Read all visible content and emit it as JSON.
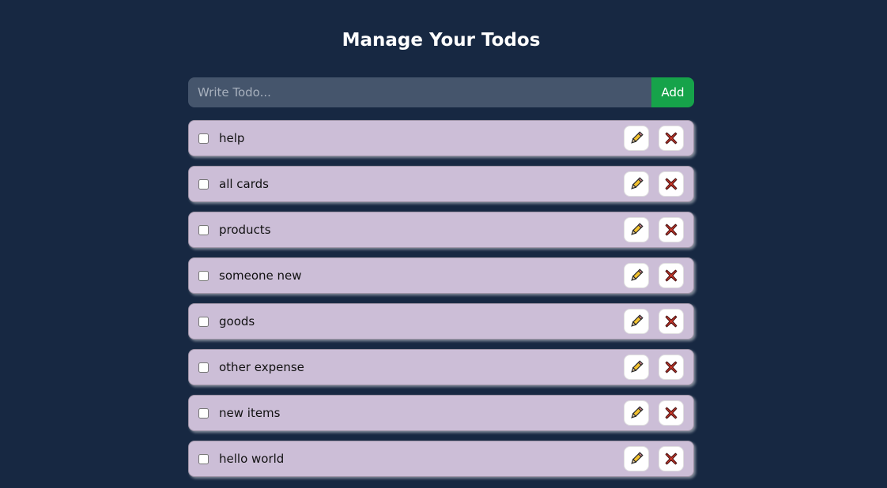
{
  "header": {
    "title": "Manage Your Todos"
  },
  "form": {
    "placeholder": "Write Todo...",
    "value": "",
    "add_label": "Add"
  },
  "todos": [
    {
      "text": "help",
      "completed": false
    },
    {
      "text": "all cards",
      "completed": false
    },
    {
      "text": "products",
      "completed": false
    },
    {
      "text": "someone new",
      "completed": false
    },
    {
      "text": "goods",
      "completed": false
    },
    {
      "text": "other expense",
      "completed": false
    },
    {
      "text": "new items",
      "completed": false
    },
    {
      "text": "hello world",
      "completed": false
    }
  ],
  "icons": {
    "edit": "pencil-icon",
    "delete": "cross-mark-icon"
  },
  "colors": {
    "background": "#172842",
    "input": "#45556c",
    "add_button": "#16a34a",
    "todo_item": "#ccbed7",
    "delete_cross": "#d23a2a",
    "pencil": "#f2c12e"
  }
}
